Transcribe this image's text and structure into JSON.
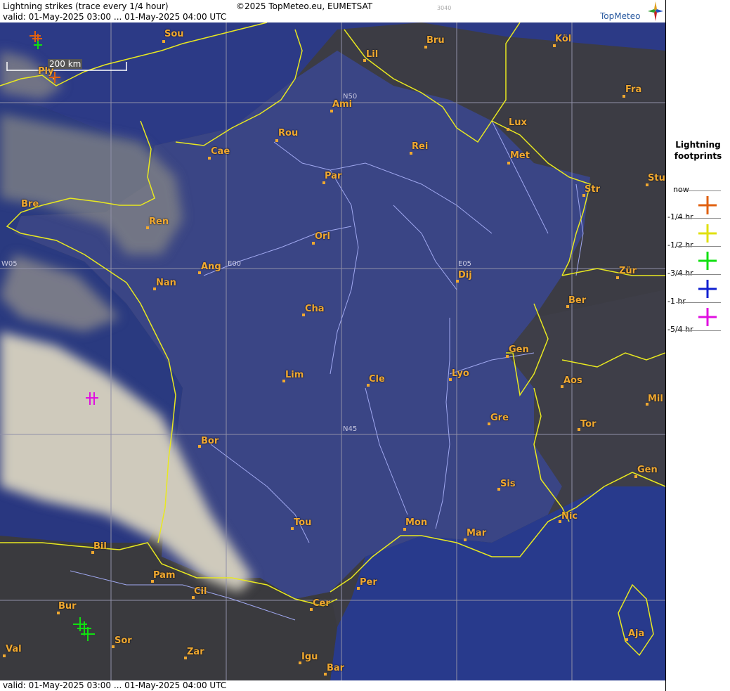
{
  "header": {
    "title": "Lightning strikes (trace every 1/4 hour)",
    "valid": "valid:  01-May-2025 03:00 ... 01-May-2025 04:00 UTC",
    "copyright": "©2025 TopMeteo.eu, EUMETSAT",
    "image_id": "3040",
    "logo_text": "TopMeteo"
  },
  "footer": {
    "valid": "valid:  01-May-2025 03:00 ... 01-May-2025 04:00 UTC"
  },
  "scale": {
    "label": "200 km"
  },
  "grid_labels": {
    "n50": "N50",
    "n45": "N45",
    "e00": "E00",
    "e05": "E05",
    "w05": "W05"
  },
  "legend": {
    "title_line1": "Lightning",
    "title_line2": "footprints",
    "items": [
      {
        "label": "now",
        "color": ""
      },
      {
        "label": "-1/4 hr",
        "color": "#e06010"
      },
      {
        "label": "-1/2 hr",
        "color": "#e0e010"
      },
      {
        "label": "-3/4 hr",
        "color": "#10e010"
      },
      {
        "label": "-1 hr",
        "color": "#1020d0"
      },
      {
        "label": "-5/4 hr",
        "color": "#e010e0"
      }
    ]
  },
  "cities": {
    "sou": "Sou",
    "bru": "Bru",
    "kol": "Köl",
    "lil": "Lil",
    "ply": "Ply",
    "fra": "Fra",
    "ami": "Ami",
    "lux": "Lux",
    "rou": "Rou",
    "cae": "Cae",
    "rei": "Rei",
    "met": "Met",
    "par": "Par",
    "stu": "Stu",
    "str": "Str",
    "bre": "Bre",
    "ren": "Ren",
    "orl": "Orl",
    "ang": "Ang",
    "nan": "Nan",
    "dij": "Dij",
    "zur": "Zür",
    "cha": "Cha",
    "ber": "Ber",
    "gen1": "Gen",
    "lim": "Lim",
    "cle": "Cle",
    "lyo": "Lyo",
    "aos": "Aos",
    "mil": "Mil",
    "gre": "Gre",
    "tor": "Tor",
    "bor": "Bor",
    "gen2": "Gen",
    "sis": "Sis",
    "nic": "Nic",
    "tou": "Tou",
    "mon": "Mon",
    "mar": "Mar",
    "bil": "Bil",
    "pam": "Pam",
    "cil": "Cil",
    "per": "Per",
    "cer": "Cer",
    "bur": "Bur",
    "sor": "Sor",
    "val": "Val",
    "zar": "Zar",
    "igu": "Igu",
    "bar": "Bar",
    "aja": "Aja"
  },
  "colors": {
    "land_dark": "#3a3a42",
    "france_blue": "#3a4a8a",
    "sea": "#283a88",
    "cloud": "#c8c4b8",
    "border": "#e8e820",
    "river": "#a0a8f0",
    "grid": "#9090a8",
    "city": "#f0a830"
  },
  "strikes": [
    {
      "region": "english-channel-ply",
      "age": "-1/4 hr"
    },
    {
      "region": "english-channel-north",
      "age": "-1/4 hr"
    },
    {
      "region": "english-channel-north",
      "age": "-3/4 hr"
    },
    {
      "region": "bay-of-biscay",
      "age": "-5/4 hr"
    },
    {
      "region": "northern-spain-bur",
      "age": "-3/4 hr"
    }
  ]
}
